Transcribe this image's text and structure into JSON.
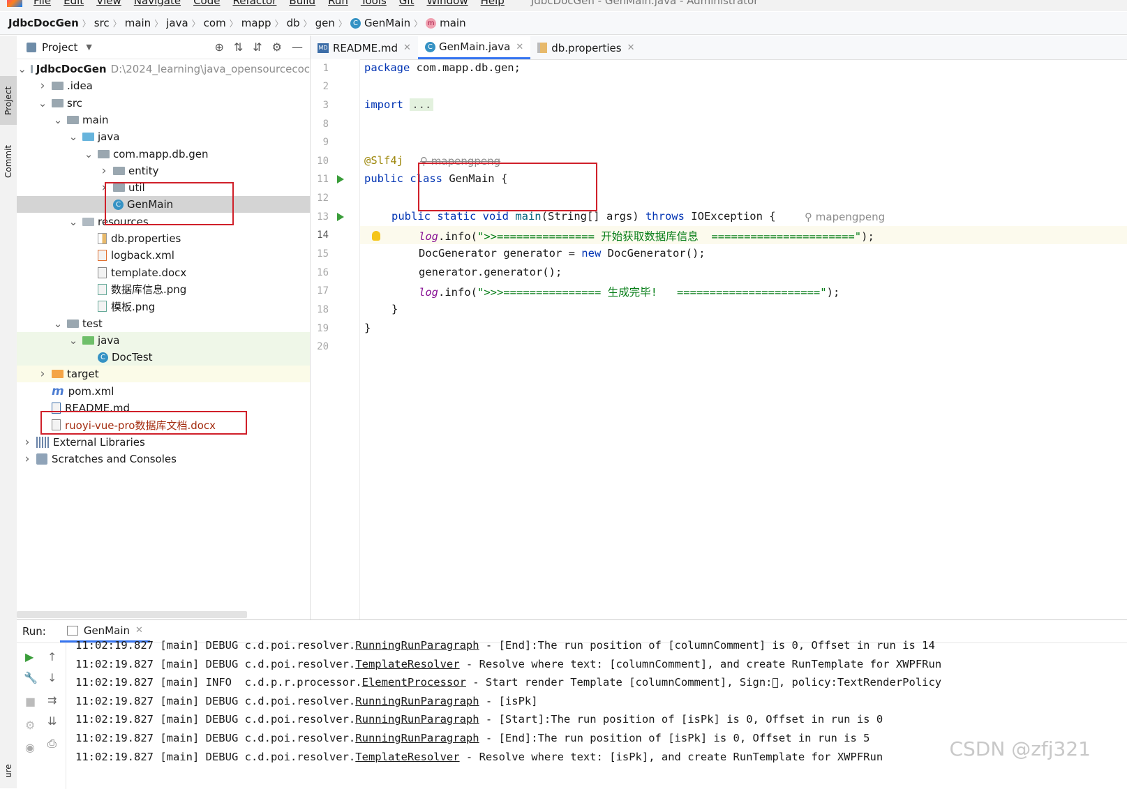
{
  "menubar": {
    "items": [
      "File",
      "Edit",
      "View",
      "Navigate",
      "Code",
      "Refactor",
      "Build",
      "Run",
      "Tools",
      "Git",
      "Window",
      "Help"
    ],
    "window_title": "JdbcDocGen - GenMain.java - Administrator"
  },
  "breadcrumb": [
    "JdbcDocGen",
    "src",
    "main",
    "java",
    "com",
    "mapp",
    "db",
    "gen",
    "GenMain",
    "main"
  ],
  "left_strip": {
    "project_tab": "Project",
    "commit_tab": "Commit",
    "structure_tab": "ure"
  },
  "project_panel": {
    "title": "Project",
    "tree": [
      {
        "label": "JdbcDocGen",
        "path": "D:\\2024_learning\\java_opensourcecoc",
        "level": 0,
        "expanded": true,
        "icon": "module-folder-icon"
      },
      {
        "label": ".idea",
        "level": 1,
        "expanded": false,
        "icon": "folder-icon"
      },
      {
        "label": "src",
        "level": 1,
        "expanded": true,
        "icon": "folder-icon"
      },
      {
        "label": "main",
        "level": 2,
        "expanded": true,
        "icon": "folder-icon"
      },
      {
        "label": "java",
        "level": 3,
        "expanded": true,
        "icon": "source-folder-icon"
      },
      {
        "label": "com.mapp.db.gen",
        "level": 4,
        "expanded": true,
        "icon": "package-icon"
      },
      {
        "label": "entity",
        "level": 5,
        "expanded": false,
        "icon": "package-icon"
      },
      {
        "label": "util",
        "level": 5,
        "expanded": false,
        "icon": "package-icon"
      },
      {
        "label": "GenMain",
        "level": 5,
        "icon": "java-class-icon",
        "selected": true
      },
      {
        "label": "resources",
        "level": 3,
        "expanded": true,
        "icon": "resources-folder-icon"
      },
      {
        "label": "db.properties",
        "level": 4,
        "icon": "properties-file-icon"
      },
      {
        "label": "logback.xml",
        "level": 4,
        "icon": "xml-file-icon"
      },
      {
        "label": "template.docx",
        "level": 4,
        "icon": "docx-file-icon"
      },
      {
        "label": "数据库信息.png",
        "level": 4,
        "icon": "image-file-icon"
      },
      {
        "label": "模板.png",
        "level": 4,
        "icon": "image-file-icon"
      },
      {
        "label": "test",
        "level": 2,
        "expanded": true,
        "icon": "folder-icon"
      },
      {
        "label": "java",
        "level": 3,
        "expanded": true,
        "icon": "test-folder-icon"
      },
      {
        "label": "DocTest",
        "level": 4,
        "icon": "java-class-icon"
      },
      {
        "label": "target",
        "level": 1,
        "expanded": false,
        "icon": "excluded-folder-icon"
      },
      {
        "label": "pom.xml",
        "level": 1,
        "icon": "maven-icon"
      },
      {
        "label": "README.md",
        "level": 1,
        "icon": "markdown-file-icon"
      },
      {
        "label": "ruoyi-vue-pro数据库文档.docx",
        "level": 1,
        "icon": "docx-file-icon",
        "untracked": true
      },
      {
        "label": "External Libraries",
        "level": 0,
        "expanded": false,
        "icon": "library-icon"
      },
      {
        "label": "Scratches and Consoles",
        "level": 0,
        "expanded": false,
        "icon": "scratches-icon"
      }
    ]
  },
  "editor": {
    "tabs": [
      {
        "label": "README.md",
        "icon": "markdown-file-icon",
        "active": false
      },
      {
        "label": "GenMain.java",
        "icon": "java-class-icon",
        "active": true
      },
      {
        "label": "db.properties",
        "icon": "properties-file-icon",
        "active": false
      }
    ],
    "line_numbers": [
      "1",
      "2",
      "3",
      "8",
      "9",
      "10",
      "11",
      "12",
      "13",
      "14",
      "15",
      "16",
      "17",
      "18",
      "19",
      "20"
    ],
    "current_line": "14",
    "code": {
      "l1_kw": "package",
      "l1_rest": " com.mapp.db.gen;",
      "l3_kw": "import",
      "l3_dots": "...",
      "l10_ann": "@Slf4j",
      "l10_author": "mapengpeng",
      "l11_kw": "public class",
      "l11_rest": " GenMain {",
      "l13_kw1": "public static void",
      "l13_fn": " main",
      "l13_mid": "(String[] args) ",
      "l13_kw2": "throws",
      "l13_rest": " IOException {",
      "l13_author": "mapengpeng",
      "l14_fld": "log",
      "l14_mid": ".info(",
      "l14_str": "\">>=============== 开始获取数据库信息  ======================\"",
      "l14_end": ");",
      "l15_a": "DocGenerator generator = ",
      "l15_kw": "new",
      "l15_b": " DocGenerator();",
      "l16": "generator.generator();",
      "l17_fld": "log",
      "l17_mid": ".info(",
      "l17_str": "\">>>=============== 生成完毕!   ======================\"",
      "l17_end": ");",
      "l18": "}",
      "l19": "}"
    }
  },
  "run_panel": {
    "label": "Run:",
    "tab": "GenMain",
    "lines": [
      {
        "pre": "11:02:19.827 [main] DEBUG c.d.poi.resolver.",
        "cls": "RunningRunParagraph",
        "post": " - [End]:The run position of [columnComment] is 0, Offset in run is 14"
      },
      {
        "pre": "11:02:19.827 [main] DEBUG c.d.poi.resolver.",
        "cls": "TemplateResolver",
        "post": " - Resolve where text: [columnComment], and create RunTemplate for XWPFRun"
      },
      {
        "pre": "11:02:19.827 [main] INFO  c.d.p.r.processor.",
        "cls": "ElementProcessor",
        "post": " - Start render Template [columnComment], Sign:\u0000, policy:TextRenderPolicy"
      },
      {
        "pre": "11:02:19.827 [main] DEBUG c.d.poi.resolver.",
        "cls": "RunningRunParagraph",
        "post": " - [isPk]"
      },
      {
        "pre": "11:02:19.827 [main] DEBUG c.d.poi.resolver.",
        "cls": "RunningRunParagraph",
        "post": " - [Start]:The run position of [isPk] is 0, Offset in run is 0"
      },
      {
        "pre": "11:02:19.827 [main] DEBUG c.d.poi.resolver.",
        "cls": "RunningRunParagraph",
        "post": " - [End]:The run position of [isPk] is 0, Offset in run is 5"
      },
      {
        "pre": "11:02:19.827 [main] DEBUG c.d.poi.resolver.",
        "cls": "TemplateResolver",
        "post": " - Resolve where text: [isPk], and create RunTemplate for XWPFRun"
      }
    ]
  },
  "watermark": "CSDN @zfj321",
  "colors": {
    "keyword": "#0033b3",
    "string": "#067d17",
    "annotation": "#9e880d",
    "field": "#871094",
    "highlight_box": "#d0202a",
    "accent": "#3574f0"
  }
}
